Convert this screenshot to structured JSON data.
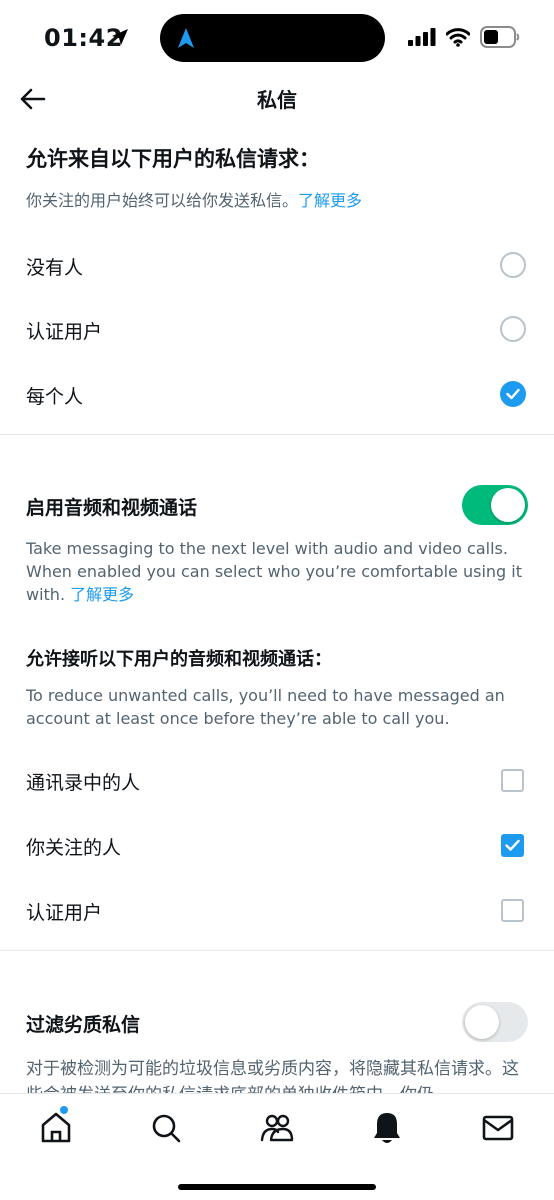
{
  "status_bar": {
    "time": "01:42"
  },
  "header": {
    "title": "私信"
  },
  "requests": {
    "title": "允许来自以下用户的私信请求：",
    "desc": "你关注的用户始终可以给你发送私信。",
    "learn_more": "了解更多",
    "options": [
      {
        "label": "没有人",
        "checked": false
      },
      {
        "label": "认证用户",
        "checked": false
      },
      {
        "label": "每个人",
        "checked": true
      }
    ]
  },
  "calls": {
    "toggle_label": "启用音频和视频通话",
    "toggle_on": true,
    "desc": "Take messaging to the next level with audio and video calls. When enabled you can select who you’re comfortable using it with.",
    "learn_more": "了解更多",
    "allow_title": "允许接听以下用户的音频和视频通话：",
    "allow_desc": "To reduce unwanted calls, you’ll need to have messaged an account at least once before they’re able to call you.",
    "options": [
      {
        "label": "通讯录中的人",
        "checked": false
      },
      {
        "label": "你关注的人",
        "checked": true
      },
      {
        "label": "认证用户",
        "checked": false
      }
    ]
  },
  "filter": {
    "toggle_label": "过滤劣质私信",
    "toggle_on": false,
    "desc": "对于被检测为可能的垃圾信息或劣质内容，将隐藏其私信请求。这些会被发送至你的私信请求底部的单独收件箱中。你仍"
  },
  "bottom_nav": {
    "items": [
      "home-icon",
      "search-icon",
      "communities-icon",
      "notifications-icon",
      "messages-icon"
    ],
    "home_badge": true
  },
  "colors": {
    "accent": "#1d9bf0",
    "toggle_on": "#00ba7c",
    "muted_text": "#536471"
  }
}
